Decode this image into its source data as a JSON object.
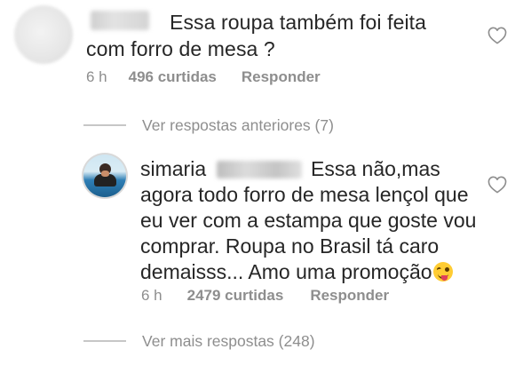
{
  "comments": [
    {
      "text_line1": "Essa roupa também foi feita",
      "text_line2": "com forro de mesa ?",
      "time": "6 h",
      "likes": "496 curtidas",
      "reply": "Responder"
    }
  ],
  "view_previous_replies": "Ver respostas anteriores (7)",
  "reply_comment": {
    "username": "simaria",
    "text_line1": "Essa não,mas",
    "text_line2": "agora todo forro de mesa lençol que",
    "text_line3": "eu ver com a estampa que goste vou",
    "text_line4": "comprar. Roupa no Brasil tá caro",
    "text_line5": "demaisss... Amo uma promoção",
    "time": "6 h",
    "likes": "2479 curtidas",
    "reply": "Responder"
  },
  "view_more_replies": "Ver mais respostas (248)",
  "colors": {
    "text": "#262626",
    "secondary": "#8e8e8e",
    "divider": "#c7c7c7"
  },
  "icons": {
    "like": "heart-outline-icon",
    "emoji": "winking-face-with-tongue-emoji"
  }
}
